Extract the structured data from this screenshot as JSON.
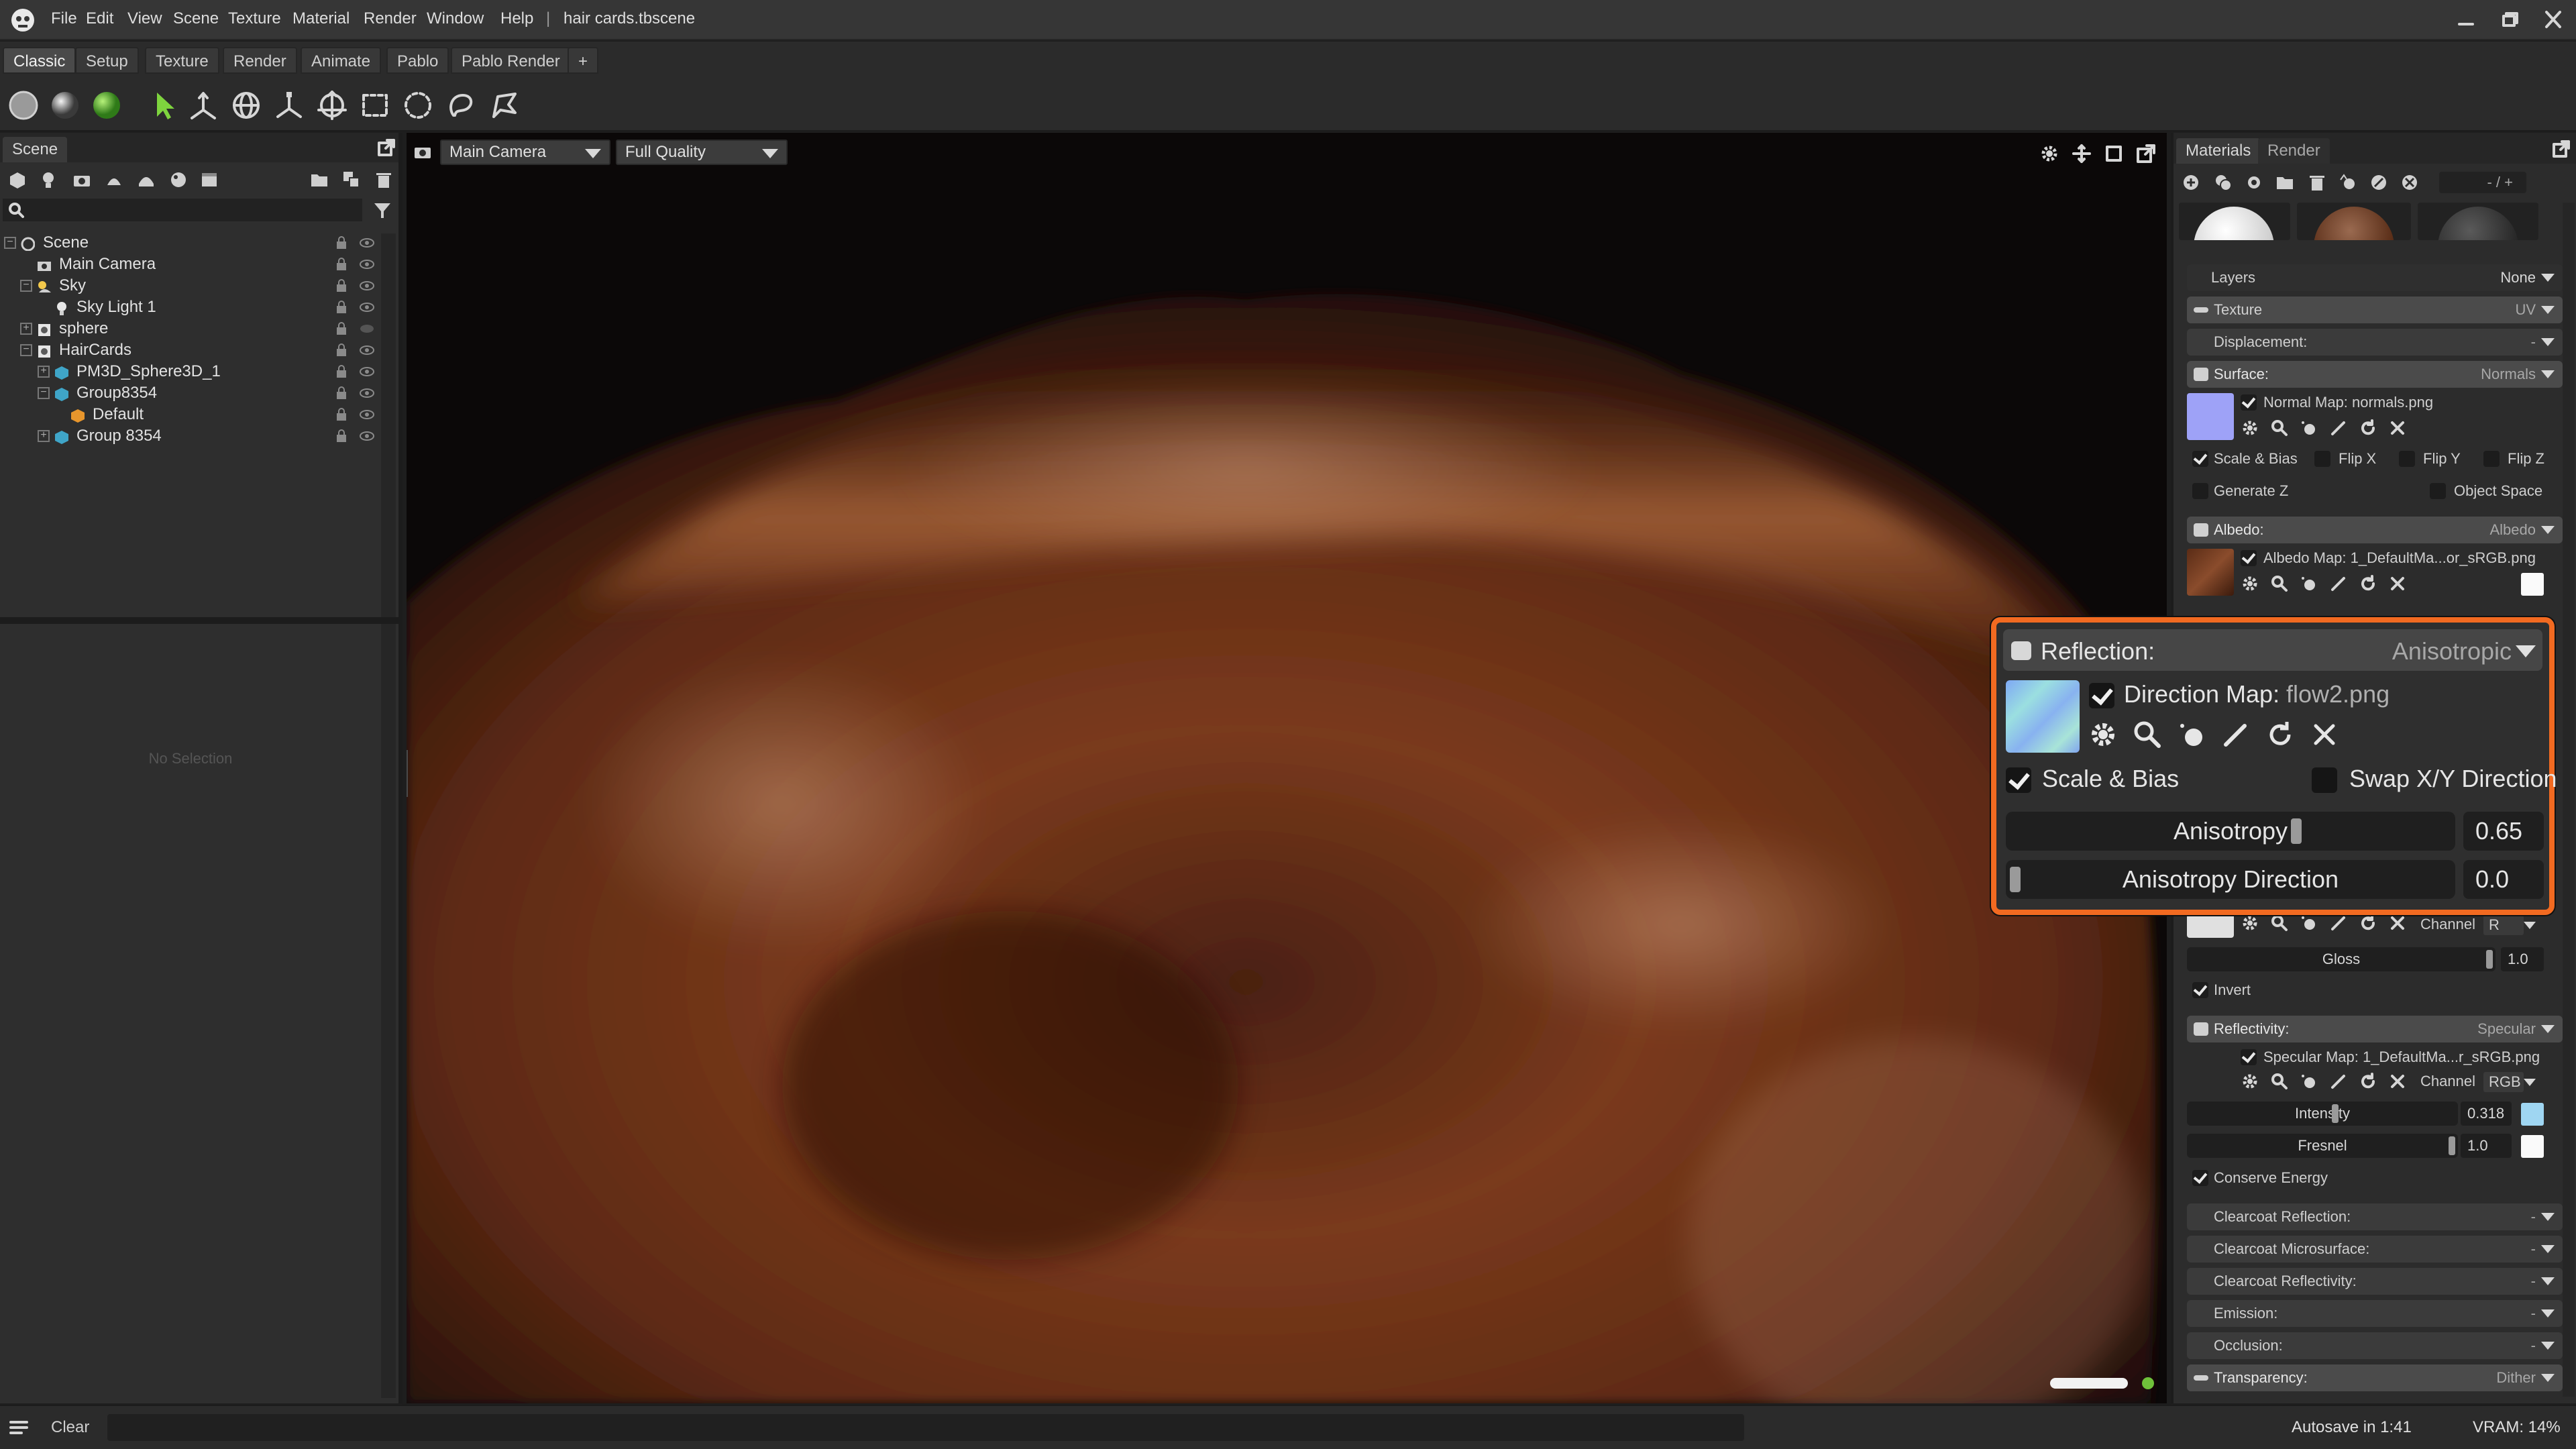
{
  "titlebar": {
    "menus": [
      "File",
      "Edit",
      "View",
      "Scene",
      "Texture",
      "Material",
      "Render",
      "Window",
      "Help"
    ],
    "separator": "|",
    "document": "hair cards.tbscene"
  },
  "workspace_tabs": [
    "Classic",
    "Setup",
    "Texture",
    "Render",
    "Animate",
    "Pablo",
    "Pablo Render",
    "+"
  ],
  "scene_panel": {
    "tab": "Scene",
    "tree": [
      {
        "label": "Scene",
        "depth": 0,
        "icon": "scene-icon"
      },
      {
        "label": "Main Camera",
        "depth": 1,
        "icon": "camera-icon"
      },
      {
        "label": "Sky",
        "depth": 1,
        "icon": "sky-icon"
      },
      {
        "label": "Sky Light 1",
        "depth": 2,
        "icon": "light-icon"
      },
      {
        "label": "sphere",
        "depth": 1,
        "icon": "mesh-icon"
      },
      {
        "label": "HairCards",
        "depth": 1,
        "icon": "mesh-icon"
      },
      {
        "label": "PM3D_Sphere3D_1",
        "depth": 2,
        "icon": "object-icon"
      },
      {
        "label": "Group8354",
        "depth": 2,
        "icon": "object-icon"
      },
      {
        "label": "Default",
        "depth": 3,
        "icon": "material-icon"
      },
      {
        "label": "Group 8354",
        "depth": 2,
        "icon": "object-icon"
      }
    ],
    "no_selection": "No Selection"
  },
  "viewport": {
    "camera": "Main Camera",
    "quality": "Full Quality"
  },
  "materials_panel": {
    "tabs": [
      "Materials",
      "Render"
    ],
    "counter": "- / +",
    "layers": {
      "label": "Layers",
      "value": "None"
    },
    "texture": {
      "label": "Texture",
      "value": "UV"
    },
    "displacement": {
      "label": "Displacement:",
      "value": "-"
    },
    "surface": {
      "label": "Surface:",
      "value": "Normals",
      "map": "Normal Map: normals.png",
      "scale_bias": "Scale & Bias",
      "flip_x": "Flip X",
      "flip_y": "Flip Y",
      "flip_z": "Flip Z",
      "generate_z": "Generate Z",
      "object_space": "Object Space"
    },
    "albedo": {
      "label": "Albedo:",
      "value": "Albedo",
      "map": "Albedo Map: 1_DefaultMa...or_sRGB.png"
    },
    "microsurface": {
      "channel_label": "Channel",
      "channel": "R",
      "gloss_label": "Gloss",
      "gloss": "1.0",
      "invert": "Invert"
    },
    "reflectivity": {
      "label": "Reflectivity:",
      "value": "Specular",
      "map": "Specular Map: 1_DefaultMa...r_sRGB.png",
      "channel_label": "Channel",
      "channel": "RGB",
      "intensity_label": "Intensity",
      "intensity": "0.318",
      "fresnel_label": "Fresnel",
      "fresnel": "1.0",
      "conserve": "Conserve Energy"
    },
    "lower_sections": [
      {
        "label": "Clearcoat Reflection:",
        "value": "-"
      },
      {
        "label": "Clearcoat Microsurface:",
        "value": "-"
      },
      {
        "label": "Clearcoat Reflectivity:",
        "value": "-"
      },
      {
        "label": "Emission:",
        "value": "-"
      },
      {
        "label": "Occlusion:",
        "value": "-"
      },
      {
        "label": "Transparency:",
        "value": "Dither"
      }
    ]
  },
  "reflection_zoom": {
    "label": "Reflection:",
    "value": "Anisotropic",
    "direction_prefix": "Direction Map:",
    "direction_file": "flow2.png",
    "scale_bias": "Scale & Bias",
    "swap": "Swap X/Y Direction",
    "anisotropy_label": "Anisotropy",
    "anisotropy": "0.65",
    "anisotropy_level": 0.65,
    "direction_label": "Anisotropy Direction",
    "direction": "0.0"
  },
  "statusbar": {
    "clear": "Clear",
    "autosave": "Autosave in 1:41",
    "vram": "VRAM: 14%"
  },
  "colors": {
    "accent_highlight": "#f26a21",
    "active_green": "#6fc13a",
    "hair_base": "#6b3217"
  }
}
